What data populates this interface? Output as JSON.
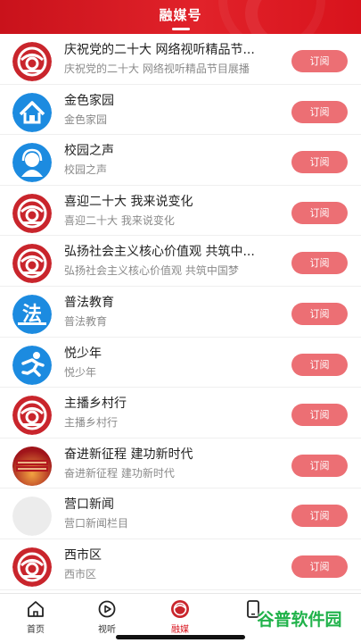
{
  "header": {
    "title": "融媒号"
  },
  "subscribe_label": "订阅",
  "items": [
    {
      "name": "庆祝党的二十大 网络视听精品节...",
      "desc": "庆祝党的二十大 网络视听精品节目展播",
      "icon": "red-emblem-icon"
    },
    {
      "name": "金色家园",
      "desc": "金色家园",
      "icon": "house-icon"
    },
    {
      "name": "校园之声",
      "desc": "校园之声",
      "icon": "headset-person-icon"
    },
    {
      "name": "喜迎二十大 我来说变化",
      "desc": "喜迎二十大 我来说变化",
      "icon": "red-emblem-icon"
    },
    {
      "name": "弘扬社会主义核心价值观 共筑中...",
      "desc": "弘扬社会主义核心价值观 共筑中国梦",
      "icon": "red-emblem-icon"
    },
    {
      "name": "普法教育",
      "desc": "普法教育",
      "icon": "law-char-icon",
      "icon_text": "法"
    },
    {
      "name": "悦少年",
      "desc": "悦少年",
      "icon": "running-person-icon"
    },
    {
      "name": "主播乡村行",
      "desc": "主播乡村行",
      "icon": "red-emblem-icon"
    },
    {
      "name": "奋进新征程 建功新时代",
      "desc": "奋进新征程 建功新时代",
      "icon": "poster-icon"
    },
    {
      "name": "营口新闻",
      "desc": "营口新闻栏目",
      "icon": "placeholder-icon"
    },
    {
      "name": "西市区",
      "desc": "西市区",
      "icon": "red-emblem-icon"
    }
  ],
  "tabbar": {
    "tabs": [
      {
        "label": "首页",
        "icon": "home-icon"
      },
      {
        "label": "视听",
        "icon": "play-icon"
      },
      {
        "label": "融媒",
        "icon": "media-icon"
      },
      {
        "label": "",
        "icon": "phone-icon"
      }
    ]
  },
  "watermark": "谷普软件园",
  "colors": {
    "brand": "#d8131c",
    "button": "#ec6f74",
    "icon_blue": "#1c8be0"
  }
}
